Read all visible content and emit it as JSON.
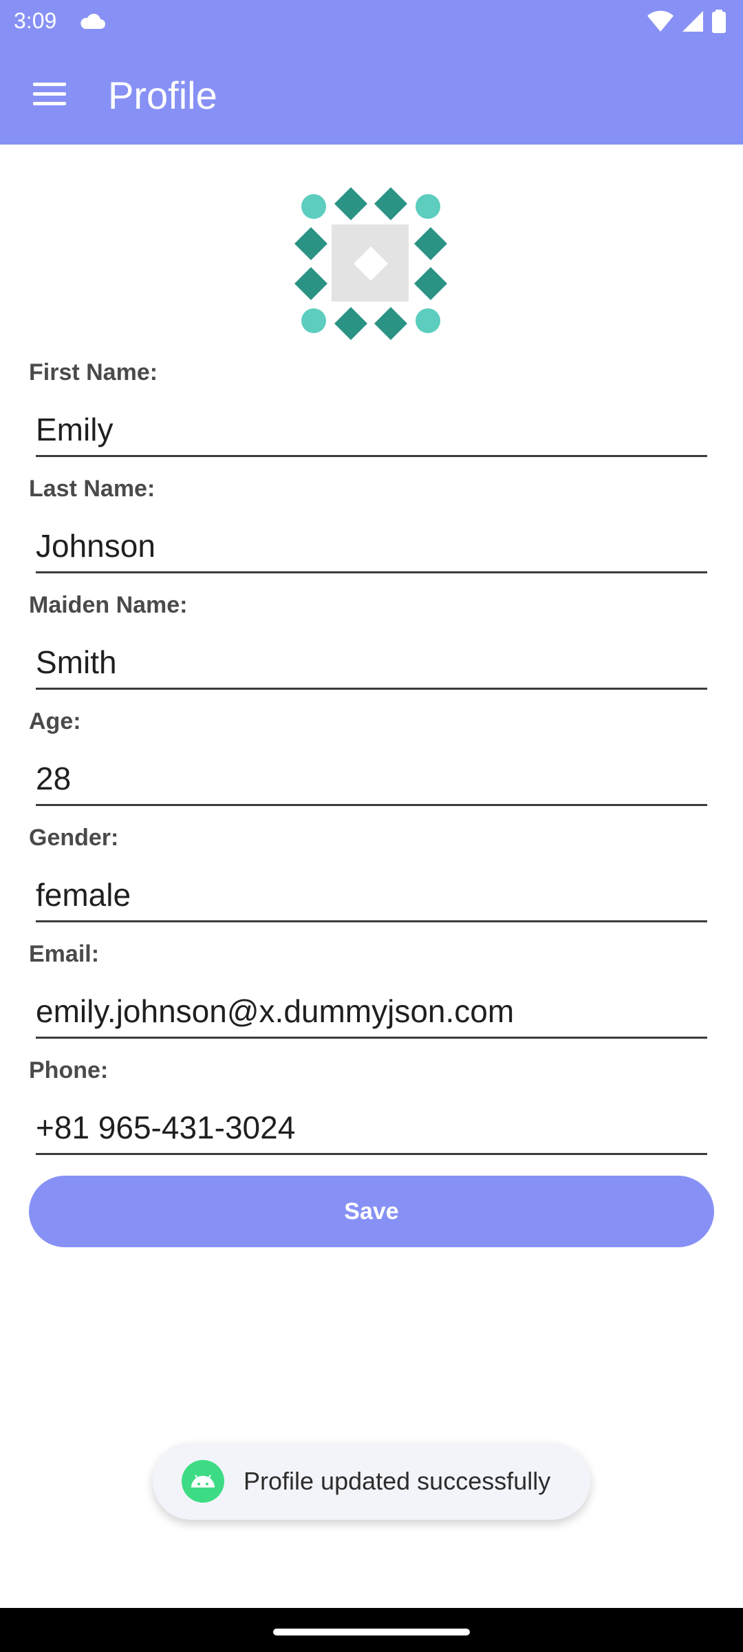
{
  "status_bar": {
    "time": "3:09",
    "icons": [
      "cloud-icon",
      "wifi-icon",
      "signal-icon",
      "battery-icon"
    ]
  },
  "app_bar": {
    "title": "Profile",
    "menu_icon": "menu-icon",
    "color": "#8791f5"
  },
  "avatar": {
    "icon": "identicon-avatar",
    "colors": [
      "#5ccdbe",
      "#2a9384",
      "#e3e3e3"
    ]
  },
  "form": {
    "first_name": {
      "label": "First Name:",
      "value": "Emily"
    },
    "last_name": {
      "label": "Last Name:",
      "value": "Johnson"
    },
    "maiden_name": {
      "label": "Maiden Name:",
      "value": "Smith"
    },
    "age": {
      "label": "Age:",
      "value": "28"
    },
    "gender": {
      "label": "Gender:",
      "value": "female"
    },
    "email": {
      "label": "Email:",
      "value": "emily.johnson@x.dummyjson.com"
    },
    "phone": {
      "label": "Phone:",
      "value": "+81 965-431-3024"
    },
    "save_label": "Save"
  },
  "toast": {
    "icon": "android-icon",
    "message": "Profile updated successfully"
  }
}
